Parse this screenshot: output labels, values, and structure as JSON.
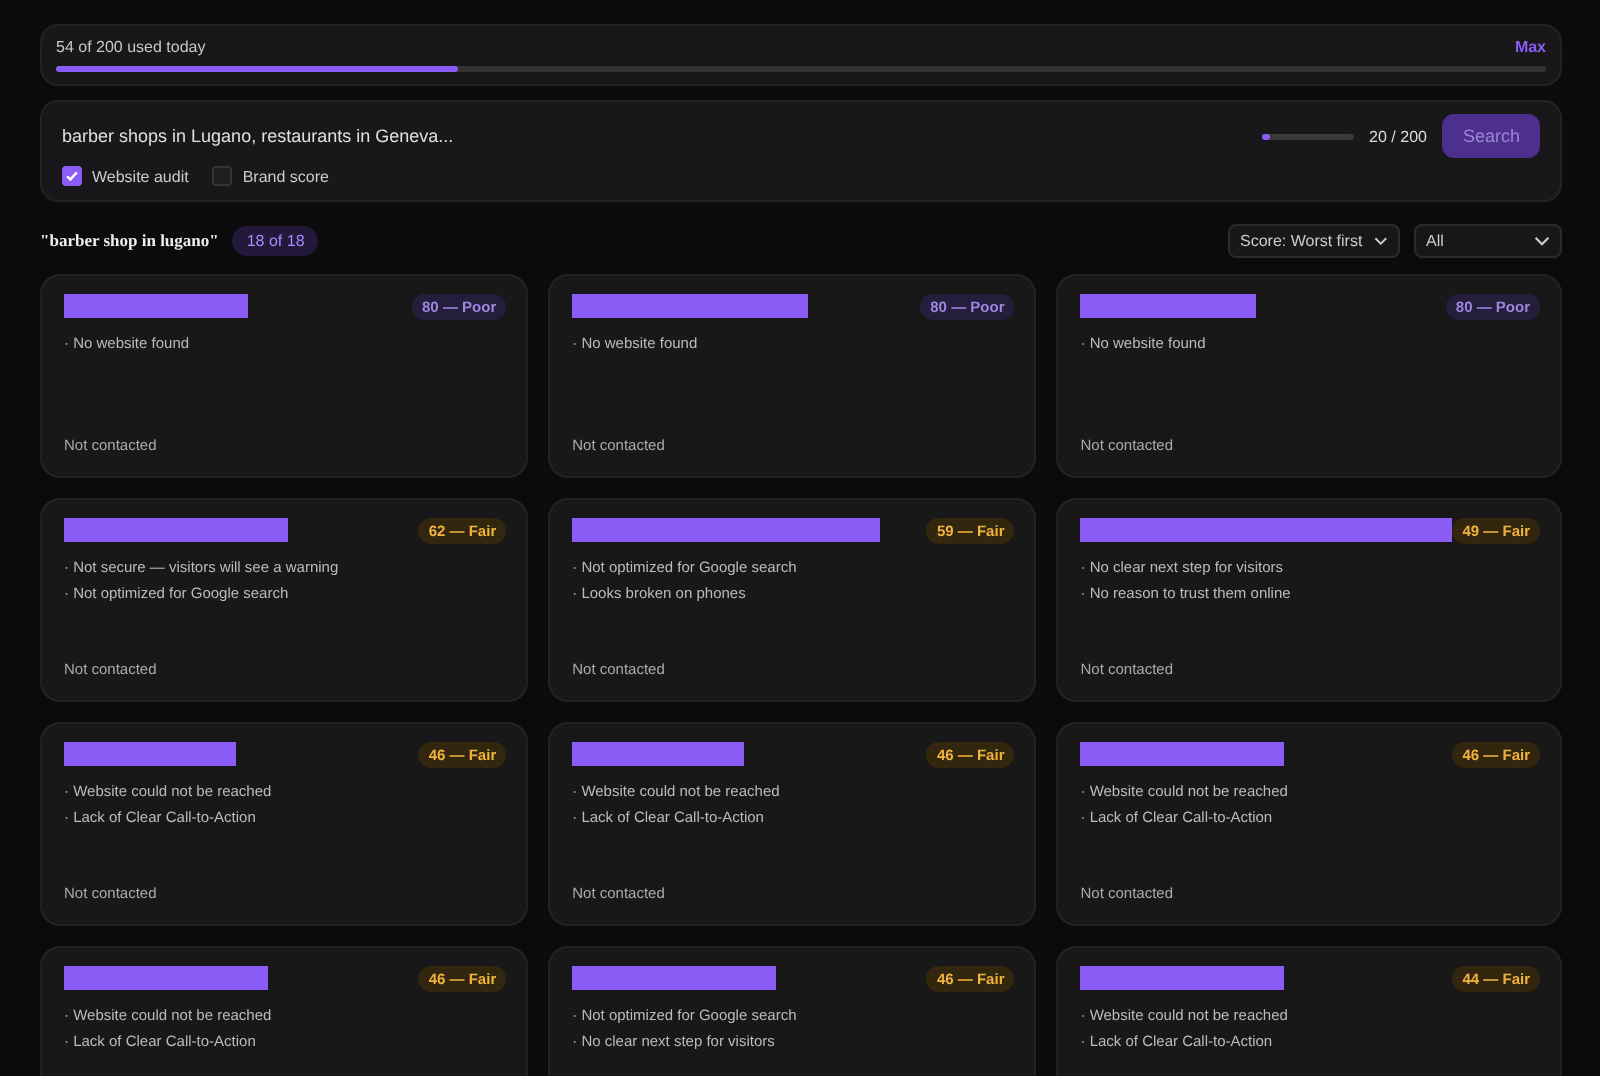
{
  "usage": {
    "label": "54 of 200 used today",
    "plan": "Max",
    "level": 0.27
  },
  "search": {
    "value": "barber shops in Lugano, restaurants in Geneva...",
    "limit": {
      "level": 0.1,
      "reading": "20 / 200"
    },
    "button": "Search",
    "options": [
      {
        "label": "Website audit",
        "checked": true
      },
      {
        "label": "Brand score",
        "checked": false
      }
    ]
  },
  "results": {
    "query": "\"barber shop in lugano\"",
    "count": "18 of 18",
    "sort": "Score: Worst first",
    "filter": "All"
  },
  "cards": [
    {
      "score": "80 — Poor",
      "kind": "poor",
      "issues": [
        "· No website found"
      ],
      "status": "Not contacted"
    },
    {
      "score": "80 — Poor",
      "kind": "poor",
      "issues": [
        "· No website found"
      ],
      "status": "Not contacted"
    },
    {
      "score": "80 — Poor",
      "kind": "poor",
      "issues": [
        "· No website found"
      ],
      "status": "Not contacted"
    },
    {
      "score": "62 — Fair",
      "kind": "fair",
      "issues": [
        "· Not secure — visitors will see a warning",
        "· Not optimized for Google search"
      ],
      "status": "Not contacted"
    },
    {
      "score": "59 — Fair",
      "kind": "fair",
      "issues": [
        "· Not optimized for Google search",
        "· Looks broken on phones"
      ],
      "status": "Not contacted"
    },
    {
      "score": "49 — Fair",
      "kind": "fair",
      "issues": [
        "· No clear next step for visitors",
        "· No reason to trust them online"
      ],
      "status": "Not contacted"
    },
    {
      "score": "46 — Fair",
      "kind": "fair",
      "issues": [
        "· Website could not be reached",
        "· Lack of Clear Call-to-Action"
      ],
      "status": "Not contacted"
    },
    {
      "score": "46 — Fair",
      "kind": "fair",
      "issues": [
        "· Website could not be reached",
        "· Lack of Clear Call-to-Action"
      ],
      "status": "Not contacted"
    },
    {
      "score": "46 — Fair",
      "kind": "fair",
      "issues": [
        "· Website could not be reached",
        "· Lack of Clear Call-to-Action"
      ],
      "status": "Not contacted"
    },
    {
      "score": "46 — Fair",
      "kind": "fair",
      "issues": [
        "· Website could not be reached",
        "· Lack of Clear Call-to-Action"
      ]
    },
    {
      "score": "46 — Fair",
      "kind": "fair",
      "issues": [
        "· Not optimized for Google search",
        "· No clear next step for visitors"
      ]
    },
    {
      "score": "44 — Fair",
      "kind": "fair",
      "issues": [
        "· Website could not be reached",
        "· Lack of Clear Call-to-Action"
      ]
    }
  ]
}
